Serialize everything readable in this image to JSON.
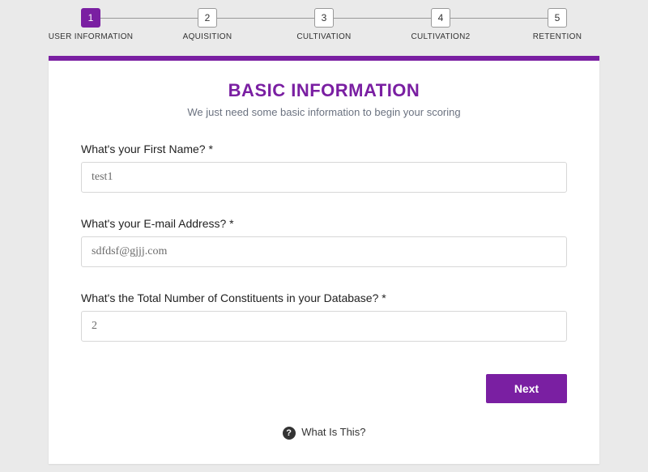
{
  "stepper": {
    "steps": [
      {
        "num": "1",
        "label": "USER INFORMATION",
        "active": true
      },
      {
        "num": "2",
        "label": "AQUISITION",
        "active": false
      },
      {
        "num": "3",
        "label": "CULTIVATION",
        "active": false
      },
      {
        "num": "4",
        "label": "CULTIVATION2",
        "active": false
      },
      {
        "num": "5",
        "label": "RETENTION",
        "active": false
      }
    ]
  },
  "header": {
    "title": "BASIC INFORMATION",
    "subtitle": "We just need some basic information to begin your scoring"
  },
  "fields": {
    "first_name": {
      "label": "What's your First Name? *",
      "value": "test1"
    },
    "email": {
      "label": "What's your E-mail Address? *",
      "value": "sdfdsf@gjjj.com"
    },
    "constituents": {
      "label": "What's the Total Number of Constituents in your Database? *",
      "value": "2"
    }
  },
  "actions": {
    "next": "Next"
  },
  "footer": {
    "help_text": "What Is This?",
    "help_icon_glyph": "?"
  },
  "colors": {
    "accent": "#7a1fa2"
  }
}
